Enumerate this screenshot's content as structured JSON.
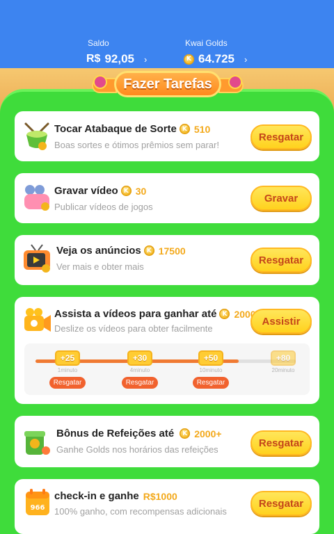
{
  "header": {
    "saldo": {
      "label": "Saldo",
      "currency": "R$",
      "value": "92,05",
      "chevron": "›"
    },
    "golds": {
      "label": "Kwai Golds",
      "value": "64.725",
      "chevron": "›"
    }
  },
  "banner": {
    "title": "Fazer Tarefas"
  },
  "coin_symbol": "K",
  "tasks": [
    {
      "title": "Tocar Atabaque de Sorte",
      "amount": "510",
      "subtitle": "Boas sortes e ótimos prêmios sem parar!",
      "button": "Resgatar",
      "icon": "drum-icon"
    },
    {
      "title": "Gravar vídeo",
      "amount": "30",
      "subtitle": "Publicar vídeos de jogos",
      "button": "Gravar",
      "icon": "camera-icon"
    },
    {
      "title": "Veja os anúncios",
      "amount": "17500",
      "subtitle": "Ver mais e obter mais",
      "button": "Resgatar",
      "icon": "tv-icon"
    },
    {
      "title": "Assista a vídeos para ganhar até",
      "amount": "2000",
      "subtitle": "Deslize os vídeos para obter facilmente",
      "button": "Assistir",
      "icon": "video-camera-icon"
    },
    {
      "title": "Bônus de Refeições até",
      "amount": "2000+",
      "subtitle": "Ganhe Golds nos horários das refeições",
      "button": "Resgatar",
      "icon": "meal-box-icon"
    },
    {
      "title": "check-in e ganhe",
      "amount": "R$1000",
      "subtitle": "100% ganho, com recompensas adicionais",
      "button": "Resgatar",
      "icon": "calendar-icon",
      "calendar_text": "966"
    }
  ],
  "watch_progress": {
    "progress_fraction": 0.78,
    "steps": [
      {
        "reward": "+25",
        "time": "1minuto",
        "claim": "Resgatar"
      },
      {
        "reward": "+30",
        "time": "4minuto",
        "claim": "Resgatar"
      },
      {
        "reward": "+50",
        "time": "10minuto",
        "claim": "Resgatar"
      },
      {
        "reward": "+80",
        "time": "20minuto"
      }
    ]
  },
  "colors": {
    "top_bar": "#3d84f0",
    "panel_green": "#3fdc3b",
    "button_yellow": "#ffd21e",
    "button_text": "#c4451a",
    "amount_gold": "#f3a91b",
    "claim_orange": "#f1622e"
  }
}
